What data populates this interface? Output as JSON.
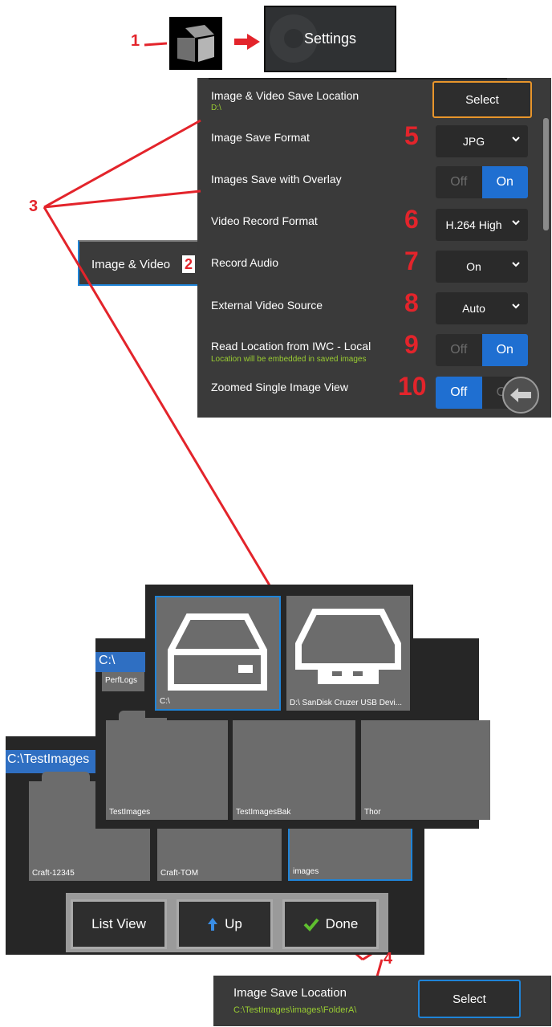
{
  "callouts": {
    "c1": "1",
    "c2": "2",
    "c3": "3",
    "c4": "4",
    "c5": "5",
    "c6": "6",
    "c7": "7",
    "c8": "8",
    "c9": "9",
    "c10": "10"
  },
  "settings_button": {
    "label": "Settings"
  },
  "side_tab": {
    "label": "Image & Video"
  },
  "settings_panel": {
    "rows": [
      {
        "label": "Image & Video Save Location",
        "sub": "D:\\",
        "control": "Select"
      },
      {
        "label": "Image Save Format",
        "value": "JPG"
      },
      {
        "label": "Images Save with Overlay",
        "off": "Off",
        "on": "On"
      },
      {
        "label": "Video Record Format",
        "value": "H.264 High"
      },
      {
        "label": "Record Audio",
        "value": "On"
      },
      {
        "label": "External Video Source",
        "value": "Auto"
      },
      {
        "label": "Read Location from IWC - Local",
        "sub": "Location will be embedded in saved images",
        "off": "Off",
        "on": "On"
      },
      {
        "label": "Zoomed Single Image View",
        "off": "Off",
        "on": "On"
      }
    ]
  },
  "file_browser": {
    "back_path": "C:\\TestImages",
    "back_folders": [
      "Craft-12345",
      "Craft-TOM",
      "images"
    ],
    "mid_path": "C:\\",
    "mid_perflogs": "PerfLogs",
    "mid_folders": [
      "TestImages",
      "TestImagesBak",
      "Thor"
    ],
    "drives": [
      "C:\\",
      "D:\\ SanDisk Cruzer USB Devi..."
    ],
    "buttons": {
      "list_view": "List View",
      "up": "Up",
      "done": "Done"
    }
  },
  "save_location": {
    "label": "Image Save Location",
    "path": "C:\\TestImages\\images\\FolderA\\",
    "button": "Select"
  },
  "colors": {
    "accent_red": "#e3242b",
    "toggle_blue": "#1f6fd1",
    "select_orange": "#e8952b",
    "path_green": "#9acd32"
  }
}
